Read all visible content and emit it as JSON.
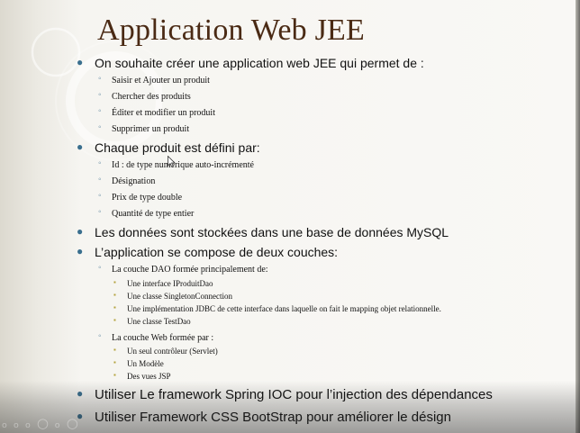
{
  "slide": {
    "title": "Application Web JEE",
    "watermark": "ₒ ₒ ₒ ○ ₒ ○",
    "items": [
      "On souhaite créer une application web JEE qui permet de :",
      "Saisir et Ajouter un produit",
      "Chercher des produits",
      "Éditer et modifier un produit",
      "Supprimer un produit",
      "Chaque produit est défini par:",
      "Id : de type numérique auto-incrémenté",
      "Désignation",
      "Prix de type double",
      "Quantité de type entier",
      "Les données sont stockées dans une base de données MySQL",
      "L’application se compose de deux couches:",
      "La couche DAO formée principalement de:",
      "Une interface IProduitDao",
      "Une classe SingletonConnection",
      "Une implémentation JDBC de cette interface dans laquelle on fait le mapping objet relationnelle.",
      "Une classe TestDao",
      "La couche Web formée par :",
      "Un seul contrôleur (Servlet)",
      "Un Modèle",
      "Des vues JSP",
      "Utiliser Le framework Spring IOC pour l’injection des dépendances",
      "Utiliser Framework CSS BootStrap pour améliorer le désign"
    ]
  },
  "theme": {
    "title_color": "#4a2a14",
    "bullet_l1_color": "#3a6f8e",
    "bullet_l2_color": "#6a8fa6",
    "bullet_l3_color": "#b3a23c"
  }
}
